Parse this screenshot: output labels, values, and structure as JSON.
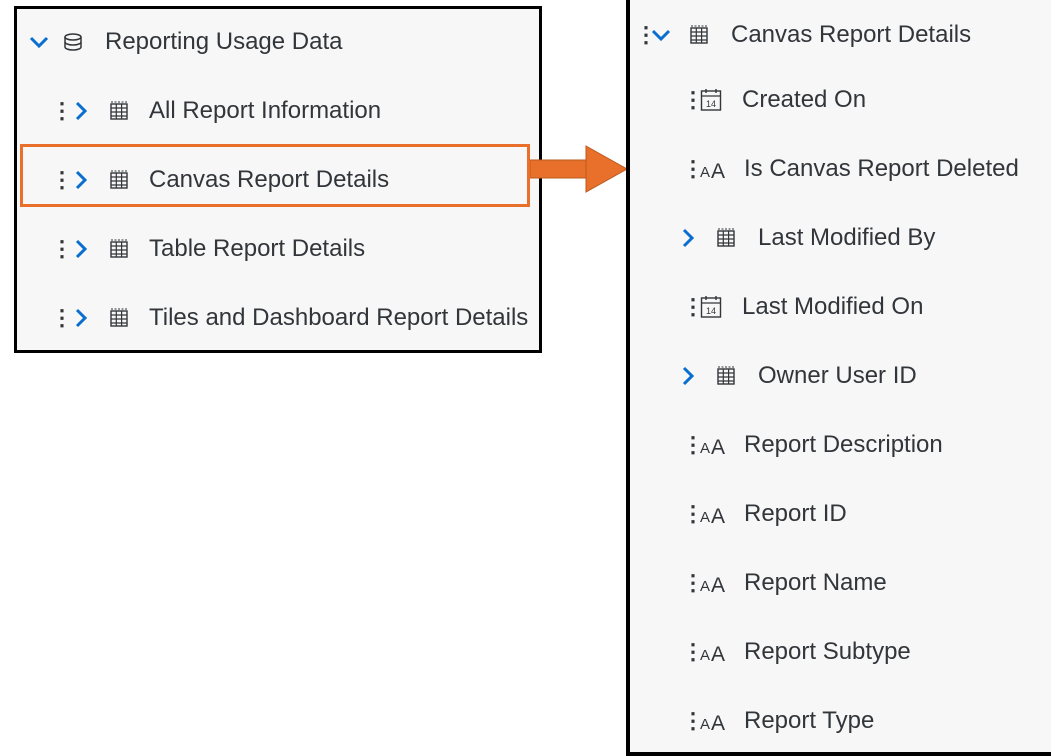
{
  "left_panel": {
    "root": {
      "label": "Reporting Usage Data",
      "icon": "database-icon",
      "expanded": true
    },
    "items": [
      {
        "label": "All Report Information",
        "icon": "table-icon"
      },
      {
        "label": "Canvas Report Details",
        "icon": "table-icon",
        "highlighted": true
      },
      {
        "label": "Table Report Details",
        "icon": "table-icon"
      },
      {
        "label": "Tiles and Dashboard Report Details",
        "icon": "table-icon"
      }
    ]
  },
  "right_panel": {
    "root": {
      "label": "Canvas Report Details",
      "icon": "table-icon",
      "expanded": true
    },
    "fields": [
      {
        "label": "Created On",
        "icon": "calendar-icon",
        "calendar_day": "14"
      },
      {
        "label": "Is Canvas Report Deleted",
        "icon": "text-type-icon"
      },
      {
        "label": "Last Modified By",
        "icon": "table-icon",
        "expandable": true
      },
      {
        "label": "Last Modified On",
        "icon": "calendar-icon",
        "calendar_day": "14"
      },
      {
        "label": "Owner User ID",
        "icon": "table-icon",
        "expandable": true
      },
      {
        "label": "Report Description",
        "icon": "text-type-icon"
      },
      {
        "label": "Report ID",
        "icon": "text-type-icon"
      },
      {
        "label": "Report Name",
        "icon": "text-type-icon"
      },
      {
        "label": "Report Subtype",
        "icon": "text-type-icon"
      },
      {
        "label": "Report Type",
        "icon": "text-type-icon"
      }
    ]
  },
  "colors": {
    "accent_blue": "#0a6ed1",
    "highlight_orange": "#e8702a",
    "text": "#32363a",
    "panel_bg": "#f7f7f7"
  }
}
